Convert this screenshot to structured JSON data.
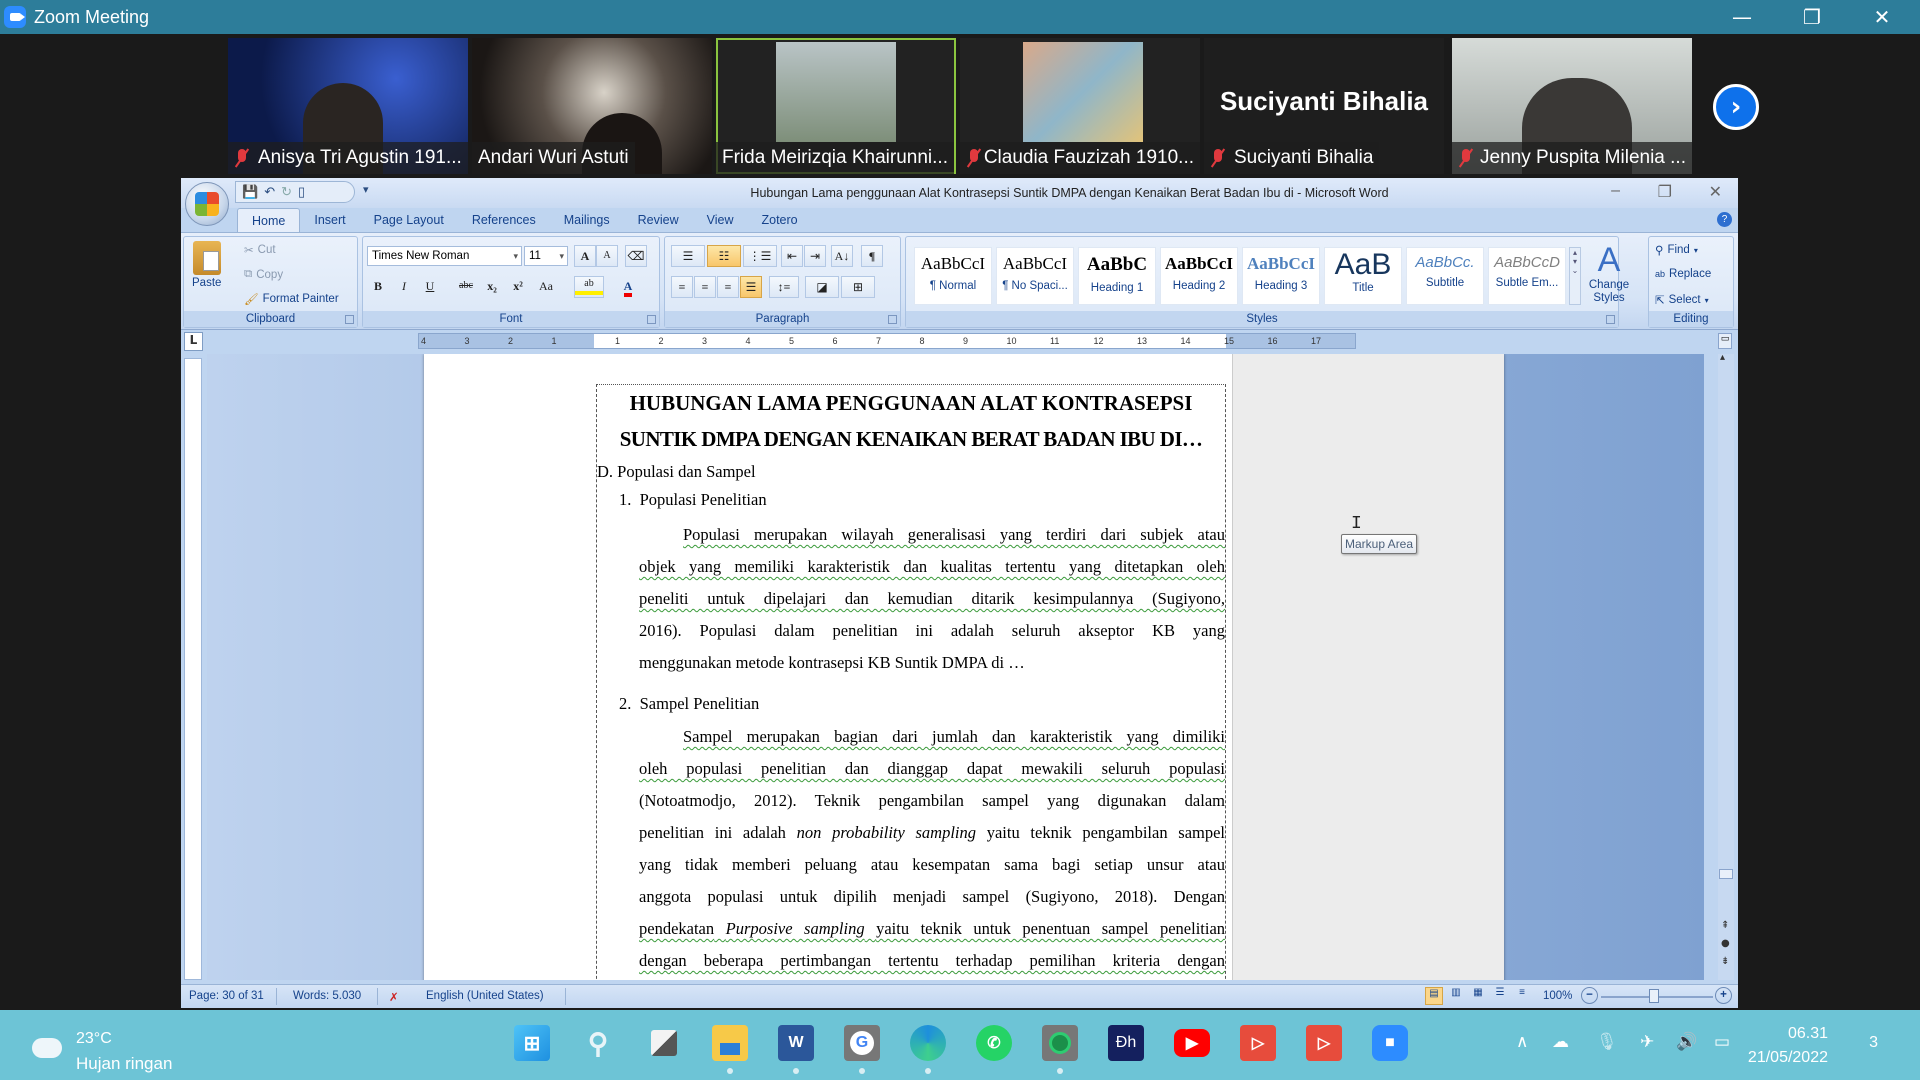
{
  "zoom": {
    "title": "Zoom Meeting",
    "window_controls": {
      "minimize": "—",
      "restore": "❐",
      "close": "✕"
    },
    "participants": [
      {
        "name": "Anisya Tri Agustin 191...",
        "muted": true
      },
      {
        "name": "Andari Wuri Astuti",
        "muted": false
      },
      {
        "name": "Frida Meirizqia Khairunni...",
        "muted": false,
        "active_speaker": true
      },
      {
        "name": "Claudia Fauzizah 1910...",
        "muted": true
      },
      {
        "name": "Suciyanti Bihalia",
        "muted": true,
        "video_off": true,
        "display_name_large": "Suciyanti Bihalia"
      },
      {
        "name": "Jenny Puspita Milenia ...",
        "muted": true
      }
    ],
    "next_page_icon": "chevron-right-icon"
  },
  "word": {
    "title": "Hubungan Lama penggunaan Alat Kontrasepsi Suntik DMPA dengan Kenaikan Berat Badan Ibu di - Microsoft Word",
    "tabs": [
      "Home",
      "Insert",
      "Page Layout",
      "References",
      "Mailings",
      "Review",
      "View",
      "Zotero"
    ],
    "active_tab": "Home",
    "clipboard": {
      "label": "Clipboard",
      "paste": "Paste",
      "cut": "Cut",
      "copy": "Copy",
      "format_painter": "Format Painter"
    },
    "font": {
      "label": "Font",
      "family": "Times New Roman",
      "size": "11",
      "grow": "A",
      "shrink": "A",
      "bold": "B",
      "italic": "I",
      "underline": "U",
      "strike": "abc",
      "subscript": "x₂",
      "superscript": "x²",
      "change_case": "Aa",
      "color_letter": "A"
    },
    "paragraph": {
      "label": "Paragraph",
      "pilcrow": "¶",
      "sort": "A↓"
    },
    "styles": {
      "label": "Styles",
      "items": [
        {
          "preview": "AaBbCcI",
          "name": "¶ Normal"
        },
        {
          "preview": "AaBbCcI",
          "name": "¶ No Spaci..."
        },
        {
          "preview": "AaBbC",
          "name": "Heading 1"
        },
        {
          "preview": "AaBbCcI",
          "name": "Heading 2"
        },
        {
          "preview": "AaBbCcI",
          "name": "Heading 3"
        },
        {
          "preview": "AaB",
          "name": "Title"
        },
        {
          "preview": "AaBbCc.",
          "name": "Subtitle"
        },
        {
          "preview": "AaBbCcD",
          "name": "Subtle Em..."
        }
      ],
      "change_styles": "Change Styles"
    },
    "editing": {
      "label": "Editing",
      "find": "Find",
      "replace": "Replace",
      "select": "Select"
    },
    "ruler_ticks": [
      "4",
      "3",
      "2",
      "1",
      "1",
      "2",
      "3",
      "4",
      "5",
      "6",
      "7",
      "8",
      "9",
      "10",
      "11",
      "12",
      "13",
      "14",
      "15",
      "16",
      "17"
    ],
    "document": {
      "title_line1": "HUBUNGAN LAMA PENGGUNAAN ALAT KONTRASEPSI",
      "title_line2": "SUNTIK DMPA DENGAN KENAIKAN BERAT BADAN IBU DI…",
      "section": "D. Populasi dan Sampel",
      "sub1": "1.  Populasi Penelitian",
      "p1": [
        "Populasi merupakan wilayah generalisasi yang terdiri dari subjek atau",
        "objek yang memiliki karakteristik dan kualitas tertentu yang ditetapkan oleh",
        "peneliti untuk dipelajari dan kemudian ditarik kesimpulannya (Sugiyono,",
        "2016). Populasi dalam penelitian ini adalah seluruh akseptor KB yang",
        "menggunakan metode kontrasepsi KB Suntik DMPA di …"
      ],
      "sub2": "2.  Sampel Penelitian",
      "p2": [
        "Sampel merupakan bagian dari jumlah dan karakteristik yang dimiliki",
        "oleh populasi penelitian dan dianggap dapat mewakili seluruh populasi",
        "(Notoatmodjo, 2012). Teknik pengambilan sampel yang digunakan dalam",
        "penelitian ini adalah",
        "non probability sampling",
        "yaitu teknik pengambilan sampel",
        "yang tidak memberi peluang atau kesempatan sama bagi setiap unsur atau",
        "anggota populasi untuk dipilih menjadi sampel (Sugiyono, 2018). Dengan",
        "pendekatan",
        "Purposive sampling",
        "yaitu teknik untuk penentuan sampel penelitian",
        "dengan beberapa pertimbangan tertentu terhadap pemilihan kriteria dengan"
      ]
    },
    "tooltip": "Markup Area",
    "status": {
      "page": "Page: 30 of 31",
      "words": "Words: 5.030",
      "language": "English (United States)",
      "zoom": "100%"
    }
  },
  "taskbar": {
    "weather_temp": "23°C",
    "weather_desc": "Hujan ringan",
    "apps": [
      "Start",
      "Search",
      "Task View",
      "File Explorer",
      "Microsoft Word",
      "Google Chrome",
      "Microsoft Edge",
      "WhatsApp",
      "App",
      "Disney+ Hotstar",
      "YouTube",
      "Media Player",
      "Media Player",
      "Zoom"
    ],
    "time": "06.31",
    "date": "21/05/2022",
    "notifications": "3"
  }
}
